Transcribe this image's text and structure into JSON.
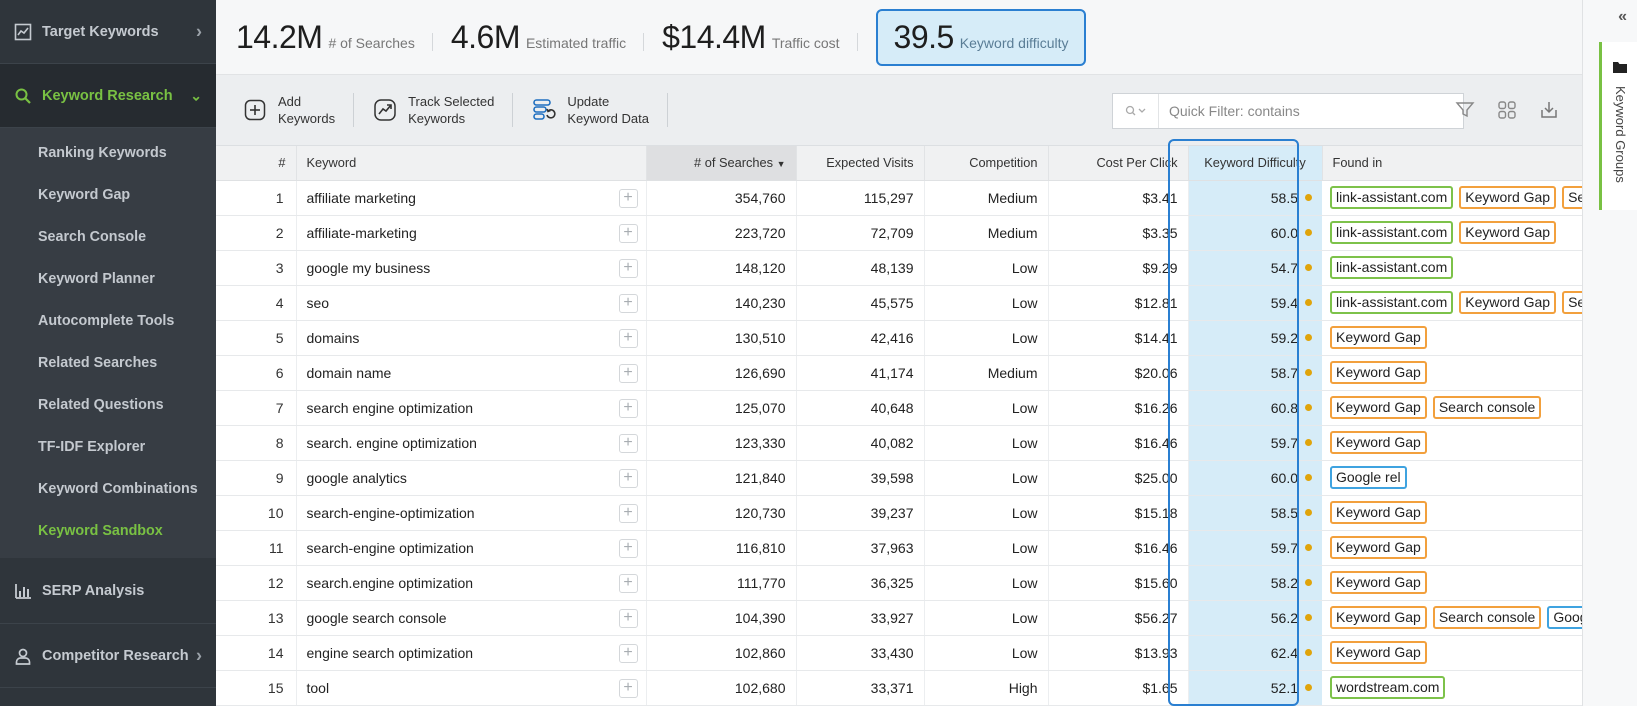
{
  "sidebar": {
    "sections": [
      {
        "label": "Target Keywords",
        "icon": "trend-chart-icon"
      },
      {
        "label": "Keyword Research",
        "icon": "search-icon"
      },
      {
        "label": "SERP Analysis",
        "icon": "bar-chart-icon"
      },
      {
        "label": "Competitor Research",
        "icon": "user-icon"
      }
    ],
    "items": [
      "Ranking Keywords",
      "Keyword Gap",
      "Search Console",
      "Keyword Planner",
      "Autocomplete Tools",
      "Related Searches",
      "Related Questions",
      "TF-IDF Explorer",
      "Keyword Combinations",
      "Keyword Sandbox"
    ]
  },
  "metrics": [
    {
      "value": "14.2M",
      "label": "# of Searches"
    },
    {
      "value": "4.6M",
      "label": "Estimated traffic"
    },
    {
      "value": "$14.4M",
      "label": "Traffic cost"
    },
    {
      "value": "39.5",
      "label": "Keyword difficulty"
    }
  ],
  "toolbar": {
    "add_line1": "Add",
    "add_line2": "Keywords",
    "track_line1": "Track Selected",
    "track_line2": "Keywords",
    "update_line1": "Update",
    "update_line2": "Keyword Data",
    "filter_placeholder": "Quick Filter: contains"
  },
  "table": {
    "headers": {
      "idx": "#",
      "keyword": "Keyword",
      "searches": "# of Searches",
      "visits": "Expected Visits",
      "competition": "Competition",
      "cpc": "Cost Per Click",
      "kd": "Keyword Difficulty",
      "found": "Found in"
    },
    "rows": [
      {
        "idx": "1",
        "keyword": "affiliate marketing",
        "searches": "354,760",
        "visits": "115,297",
        "competition": "Medium",
        "cpc": "$3.41",
        "kd": "58.5",
        "found": [
          "link-assistant.com",
          "Keyword Gap",
          "Se"
        ]
      },
      {
        "idx": "2",
        "keyword": "affiliate-marketing",
        "searches": "223,720",
        "visits": "72,709",
        "competition": "Medium",
        "cpc": "$3.35",
        "kd": "60.0",
        "found": [
          "link-assistant.com",
          "Keyword Gap"
        ]
      },
      {
        "idx": "3",
        "keyword": "google my business",
        "searches": "148,120",
        "visits": "48,139",
        "competition": "Low",
        "cpc": "$9.29",
        "kd": "54.7",
        "found": [
          "link-assistant.com"
        ]
      },
      {
        "idx": "4",
        "keyword": "seo",
        "searches": "140,230",
        "visits": "45,575",
        "competition": "Low",
        "cpc": "$12.81",
        "kd": "59.4",
        "found": [
          "link-assistant.com",
          "Keyword Gap",
          "Se"
        ]
      },
      {
        "idx": "5",
        "keyword": "domains",
        "searches": "130,510",
        "visits": "42,416",
        "competition": "Low",
        "cpc": "$14.41",
        "kd": "59.2",
        "found": [
          "Keyword Gap"
        ]
      },
      {
        "idx": "6",
        "keyword": "domain name",
        "searches": "126,690",
        "visits": "41,174",
        "competition": "Medium",
        "cpc": "$20.06",
        "kd": "58.7",
        "found": [
          "Keyword Gap"
        ]
      },
      {
        "idx": "7",
        "keyword": "search engine optimization",
        "searches": "125,070",
        "visits": "40,648",
        "competition": "Low",
        "cpc": "$16.26",
        "kd": "60.8",
        "found": [
          "Keyword Gap",
          "Search console"
        ]
      },
      {
        "idx": "8",
        "keyword": "search. engine optimization",
        "searches": "123,330",
        "visits": "40,082",
        "competition": "Low",
        "cpc": "$16.46",
        "kd": "59.7",
        "found": [
          "Keyword Gap"
        ]
      },
      {
        "idx": "9",
        "keyword": "google analytics",
        "searches": "121,840",
        "visits": "39,598",
        "competition": "Low",
        "cpc": "$25.00",
        "kd": "60.0",
        "found": [
          "Google rel"
        ]
      },
      {
        "idx": "10",
        "keyword": "search-engine-optimization",
        "searches": "120,730",
        "visits": "39,237",
        "competition": "Low",
        "cpc": "$15.18",
        "kd": "58.5",
        "found": [
          "Keyword Gap"
        ]
      },
      {
        "idx": "11",
        "keyword": "search-engine optimization",
        "searches": "116,810",
        "visits": "37,963",
        "competition": "Low",
        "cpc": "$16.46",
        "kd": "59.7",
        "found": [
          "Keyword Gap"
        ]
      },
      {
        "idx": "12",
        "keyword": "search.engine optimization",
        "searches": "111,770",
        "visits": "36,325",
        "competition": "Low",
        "cpc": "$15.60",
        "kd": "58.2",
        "found": [
          "Keyword Gap"
        ]
      },
      {
        "idx": "13",
        "keyword": "google search console",
        "searches": "104,390",
        "visits": "33,927",
        "competition": "Low",
        "cpc": "$56.27",
        "kd": "56.2",
        "found": [
          "Keyword Gap",
          "Search console",
          "Goog"
        ]
      },
      {
        "idx": "14",
        "keyword": "engine search optimization",
        "searches": "102,860",
        "visits": "33,430",
        "competition": "Low",
        "cpc": "$13.93",
        "kd": "62.4",
        "found": [
          "Keyword Gap"
        ]
      },
      {
        "idx": "15",
        "keyword": "tool",
        "searches": "102,680",
        "visits": "33,371",
        "competition": "High",
        "cpc": "$1.65",
        "kd": "52.1",
        "found": [
          "wordstream.com"
        ]
      }
    ]
  },
  "right_panel": {
    "tab_label": "Keyword Groups",
    "collapse_label": "«"
  },
  "colors": {
    "accent_green": "#79c143",
    "highlight_blue": "#2a7fd1",
    "highlight_fill": "#d6ecf8",
    "tag_green": "#7dc24a",
    "tag_orange": "#f2a03d",
    "tag_blue": "#3fa3e0",
    "kd_dot": "#e0a40a"
  }
}
